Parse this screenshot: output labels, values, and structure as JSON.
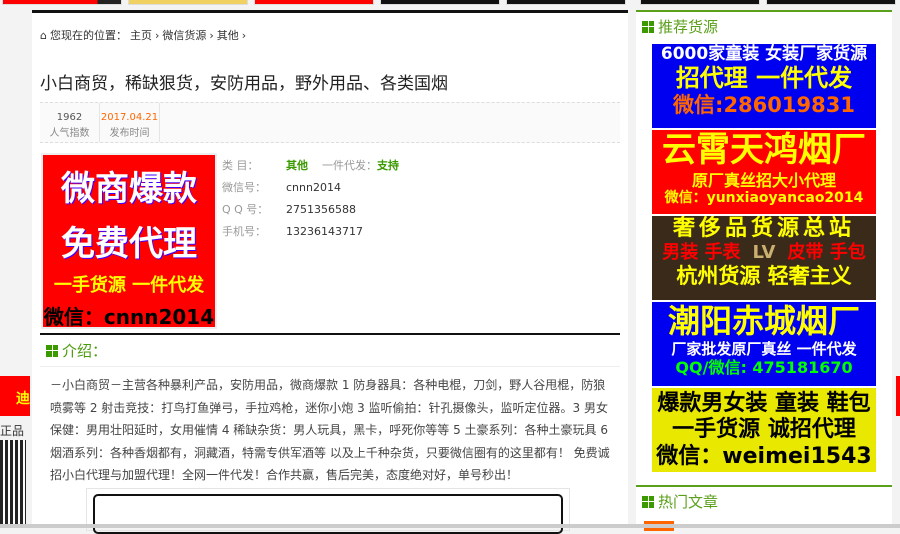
{
  "breadcrumb": {
    "prefix": "您现在的位置：",
    "items": [
      "主页",
      "微信货源",
      "其他"
    ]
  },
  "article": {
    "title": "小白商贸，稀缺狠货，安防用品，野外用品、各类国烟",
    "views": "1962",
    "views_label": "人气指数",
    "date": "2017.04.21",
    "date_label": "发布时间",
    "thumb": {
      "line1": "微商爆款",
      "line2": "免费代理",
      "line3": "一手货源 一件代发",
      "line4": "微信：cnnn2014"
    },
    "category_label": "类 目：",
    "category": "其他",
    "dropship_label": "一件代发：",
    "dropship": "支持",
    "wechat_label": "微信号：",
    "wechat": "cnnn2014",
    "qq_label": "Q Q 号：",
    "qq": "2751356588",
    "phone_label": "手机号：",
    "phone": "13236143717"
  },
  "intro": {
    "heading": "介绍：",
    "text": "－小白商贸－主营各种暴利产品，安防用品，微商爆款 1 防身器具：各种电棍，刀剑，野人谷甩棍，防狼喷雾等 2 射击竞技：打鸟打鱼弹弓，手拉鸡枪，迷你小炮 3 监听偷拍：针孔摄像头，监听定位器。3 男女保健：男用壮阳延时，女用催情 4 稀缺杂货：男人玩具，黑卡，呼死你等等 5 土豪系列：各种土豪玩具 6 烟酒系列：各种香烟都有，洞藏酒，特需专供军酒等 以及上千种杂货，只要微信圈有的这里都有！ 免费诚招小白代理与加盟代理！全网一件代发！合作共赢，售后完美，态度绝对好，单号秒出！"
  },
  "sidebar": {
    "recommended": "推荐货源",
    "hot": "热门文章",
    "ads": [
      {
        "lines": [
          "6000家童装 女装厂家货源",
          "招代理 一件代发",
          "微信:286019831"
        ]
      },
      {
        "lines": [
          "云霄天鸿烟厂",
          "原厂真丝招大小代理",
          "微信：yunxiaoyancao2014"
        ]
      },
      {
        "lines": [
          "奢侈品货源总站",
          "男装 手表",
          "皮带 手包",
          "杭州货源 轻奢主义"
        ]
      },
      {
        "lines": [
          "潮阳赤城烟厂",
          "厂家批发原厂真丝 一件代发",
          "QQ/微信: 475181670"
        ]
      },
      {
        "lines": [
          "爆款男女装 童装 鞋包",
          "一手货源 诚招代理",
          "微信：weimei1543"
        ]
      }
    ]
  },
  "left_float": {
    "ad_text": "迪",
    "label": "正品"
  }
}
